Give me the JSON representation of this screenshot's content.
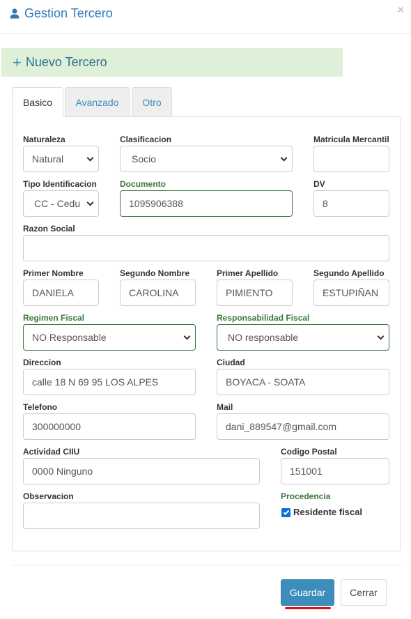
{
  "modal": {
    "title": "Gestion Tercero",
    "close_label": "×"
  },
  "banner": {
    "icon": "+",
    "title": "Nuevo Tercero"
  },
  "tabs": [
    {
      "label": "Basico",
      "active": true
    },
    {
      "label": "Avanzado",
      "active": false
    },
    {
      "label": "Otro",
      "active": false
    }
  ],
  "form": {
    "naturaleza": {
      "label": "Naturaleza",
      "value": "Natural"
    },
    "clasificacion": {
      "label": "Clasificacion",
      "value": "Socio"
    },
    "matricula": {
      "label": "Matricula Mercantil",
      "value": ""
    },
    "tipo_identificacion": {
      "label": "Tipo Identificacion",
      "value": "CC - Cedu"
    },
    "documento": {
      "label": "Documento",
      "value": "1095906388"
    },
    "dv": {
      "label": "DV",
      "value": "8"
    },
    "razon_social": {
      "label": "Razon Social",
      "value": ""
    },
    "primer_nombre": {
      "label": "Primer Nombre",
      "value": "DANIELA"
    },
    "segundo_nombre": {
      "label": "Segundo Nombre",
      "value": "CAROLINA"
    },
    "primer_apellido": {
      "label": "Primer Apellido",
      "value": "PIMIENTO"
    },
    "segundo_apellido": {
      "label": "Segundo Apellido",
      "value": "ESTUPIÑAN"
    },
    "regimen_fiscal": {
      "label": "Regimen Fiscal",
      "value": "NO Responsable"
    },
    "responsabilidad_fiscal": {
      "label": "Responsabilidad Fiscal",
      "value": "NO responsable"
    },
    "direccion": {
      "label": "Direccion",
      "value": "calle 18 N 69 95 LOS ALPES"
    },
    "ciudad": {
      "label": "Ciudad",
      "value": "BOYACA - SOATA"
    },
    "telefono": {
      "label": "Telefono",
      "value": "300000000"
    },
    "mail": {
      "label": "Mail",
      "value": "dani_889547@gmail.com"
    },
    "actividad_ciiu": {
      "label": "Actividad CIIU",
      "value": "0000 Ninguno"
    },
    "codigo_postal": {
      "label": "Codigo Postal",
      "value": "151001"
    },
    "observacion": {
      "label": "Observacion",
      "value": ""
    },
    "procedencia": {
      "label": "Procedencia",
      "checkbox_label": "Residente fiscal",
      "checked": true
    }
  },
  "footer": {
    "save_label": "Guardar",
    "close_label": "Cerrar"
  },
  "colors": {
    "primary": "#3c8dbc",
    "success_bg": "#dff0d8",
    "success_text": "#3c763d",
    "accent_underline": "#e01010"
  }
}
